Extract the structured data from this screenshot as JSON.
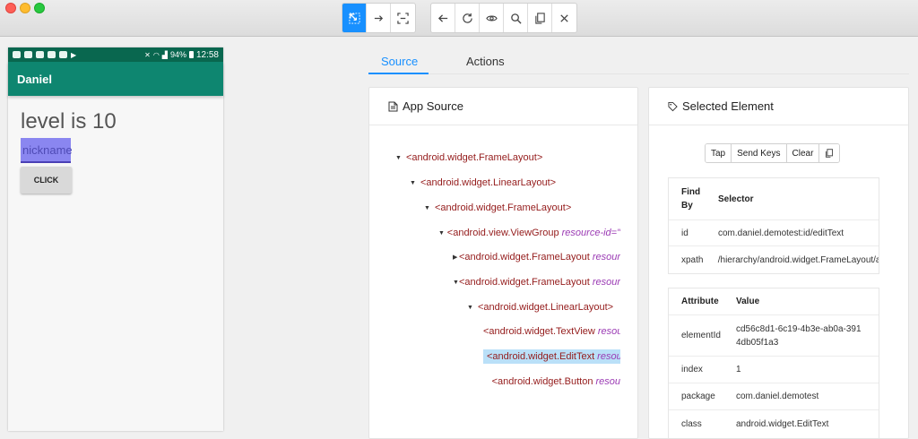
{
  "toolbar": {
    "select_icon": "pointer-icon",
    "swipe_icon": "swipe-arrow-icon",
    "tap_coords_icon": "crop-icon",
    "back_icon": "arrow-left-icon",
    "refresh_icon": "refresh-icon",
    "search_icon": "magnifier-icon",
    "view_icon": "eye-icon",
    "copy_icon": "copy-icon",
    "close_icon": "close-icon"
  },
  "phone": {
    "status_time": "12:58",
    "status_battery": "94%",
    "app_title": "Daniel",
    "level_text": "level is 10",
    "nickname_placeholder": "nickname",
    "click_button": "CLICK"
  },
  "tabs": [
    {
      "label": "Source",
      "active": true
    },
    {
      "label": "Actions",
      "active": false
    }
  ],
  "app_source": {
    "title": "App Source",
    "nodes": [
      {
        "caret": "▼",
        "tag": "<android.widget.FrameLayout>",
        "attr": ""
      },
      {
        "caret": "▼",
        "tag": "<android.widget.LinearLayout>",
        "attr": ""
      },
      {
        "caret": "▼",
        "tag": "<android.widget.FrameLayout>",
        "attr": ""
      },
      {
        "caret": "▼",
        "tag": "<android.view.ViewGroup",
        "attr": "resource-id=\""
      },
      {
        "caret": "▶",
        "tag": "<android.widget.FrameLayout",
        "attr": "resour"
      },
      {
        "caret": "▼",
        "tag": "<android.widget.FrameLayout",
        "attr": "resour"
      },
      {
        "caret": "▼",
        "tag": "<android.widget.LinearLayout>",
        "attr": ""
      },
      {
        "caret": "",
        "tag": "<android.widget.TextView",
        "attr": "resour"
      },
      {
        "caret": "",
        "tag": "<android.widget.EditText",
        "attr": "resou"
      },
      {
        "caret": "",
        "tag": "<android.widget.Button",
        "attr": "resou"
      }
    ]
  },
  "selected_element": {
    "title": "Selected Element",
    "buttons": [
      "Tap",
      "Send Keys",
      "Clear"
    ],
    "copy_icon": "copy-icon",
    "selector_table": {
      "headers": [
        "Find By",
        "Selector"
      ],
      "rows": [
        [
          "id",
          "com.daniel.demotest:id/editText"
        ],
        [
          "xpath",
          "/hierarchy/android.widget.FrameLayout/and"
        ]
      ]
    },
    "attribute_table": {
      "headers": [
        "Attribute",
        "Value"
      ],
      "rows": [
        [
          "elementId",
          "cd56c8d1-6c19-4b3e-ab0a-3914db05f1a3"
        ],
        [
          "index",
          "1"
        ],
        [
          "package",
          "com.daniel.demotest"
        ],
        [
          "class",
          "android.widget.EditText"
        ]
      ]
    }
  },
  "colors": {
    "accent": "#1890ff",
    "app_bar": "#0e8670",
    "status_bar": "#09674f",
    "tag": "#941b1b",
    "attr": "#9b3bb4",
    "selection": "#bae0f8"
  }
}
